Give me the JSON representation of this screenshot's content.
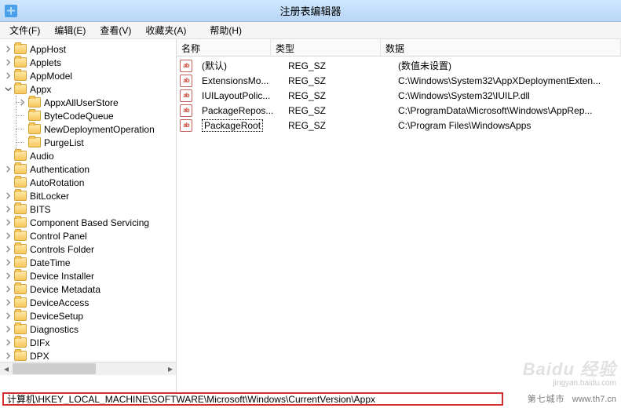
{
  "title": "注册表编辑器",
  "menus": [
    {
      "label": "文件(F)"
    },
    {
      "label": "编辑(E)"
    },
    {
      "label": "查看(V)"
    },
    {
      "label": "收藏夹(A)"
    },
    {
      "label": "帮助(H)"
    }
  ],
  "tree": {
    "items": [
      {
        "label": "AppHost",
        "expandable": true
      },
      {
        "label": "Applets",
        "expandable": true
      },
      {
        "label": "AppModel",
        "expandable": true
      },
      {
        "label": "Appx",
        "expandable": true,
        "expanded": true,
        "children": [
          {
            "label": "AppxAllUserStore",
            "expandable": true
          },
          {
            "label": "ByteCodeQueue"
          },
          {
            "label": "NewDeploymentOperation"
          },
          {
            "label": "PurgeList"
          }
        ]
      },
      {
        "label": "Audio"
      },
      {
        "label": "Authentication",
        "expandable": true
      },
      {
        "label": "AutoRotation"
      },
      {
        "label": "BitLocker",
        "expandable": true
      },
      {
        "label": "BITS",
        "expandable": true
      },
      {
        "label": "Component Based Servicing",
        "expandable": true
      },
      {
        "label": "Control Panel",
        "expandable": true
      },
      {
        "label": "Controls Folder",
        "expandable": true
      },
      {
        "label": "DateTime",
        "expandable": true
      },
      {
        "label": "Device Installer",
        "expandable": true
      },
      {
        "label": "Device Metadata",
        "expandable": true
      },
      {
        "label": "DeviceAccess",
        "expandable": true
      },
      {
        "label": "DeviceSetup",
        "expandable": true
      },
      {
        "label": "Diagnostics",
        "expandable": true
      },
      {
        "label": "DIFx",
        "expandable": true
      },
      {
        "label": "DPX",
        "expandable": true
      }
    ]
  },
  "list": {
    "columns": {
      "name": "名称",
      "type": "类型",
      "data": "数据"
    },
    "rows": [
      {
        "name": "(默认)",
        "type": "REG_SZ",
        "data": "(数值未设置)"
      },
      {
        "name": "ExtensionsMo...",
        "type": "REG_SZ",
        "data": "C:\\Windows\\System32\\AppXDeploymentExten..."
      },
      {
        "name": "IUILayoutPolic...",
        "type": "REG_SZ",
        "data": "C:\\Windows\\System32\\IUILP.dll"
      },
      {
        "name": "PackageRepos...",
        "type": "REG_SZ",
        "data": "C:\\ProgramData\\Microsoft\\Windows\\AppRep..."
      },
      {
        "name": "PackageRoot",
        "type": "REG_SZ",
        "data": "C:\\Program Files\\WindowsApps",
        "selected": true
      }
    ]
  },
  "statusbar": "计算机\\HKEY_LOCAL_MACHINE\\SOFTWARE\\Microsoft\\Windows\\CurrentVersion\\Appx",
  "value_icon_text": "ab",
  "watermark": {
    "brand": "Baidu 经验",
    "sub": "jingyan.baidu.com"
  },
  "watermark2": {
    "cn": "第七城市",
    "en": "www.th7.cn"
  }
}
